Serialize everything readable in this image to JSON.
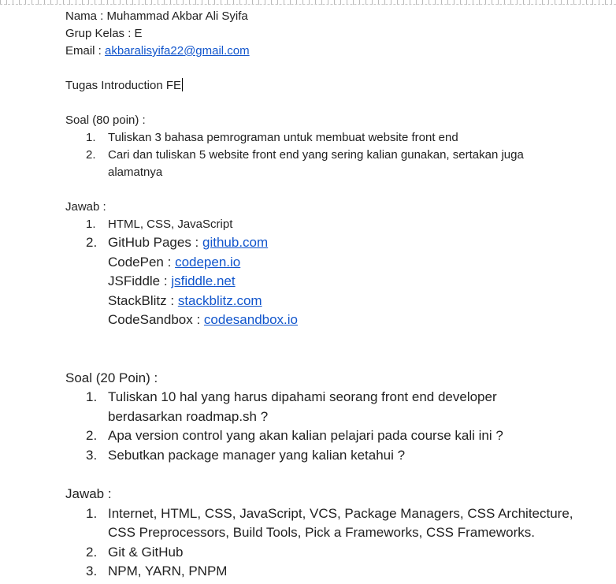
{
  "header": {
    "nama": "Nama : Muhammad Akbar Ali Syifa",
    "grup": "Grup Kelas : E",
    "email_label": "Email : ",
    "email_link": "akbaralisyifa22@gmail.com",
    "title": "Tugas Introduction FE"
  },
  "section1": {
    "soal_heading": "Soal (80 poin) :",
    "questions": [
      {
        "num": "1.",
        "text": "Tuliskan 3 bahasa pemrograman untuk membuat website front end"
      },
      {
        "num": "2.",
        "text": "Cari dan tuliskan 5 website front end yang sering kalian gunakan, sertakan juga",
        "text2": "alamatnya"
      }
    ],
    "jawab_heading": "Jawab :",
    "answer1": {
      "num": "1.",
      "text": "HTML, CSS, JavaScript"
    },
    "answer2_num": "2.",
    "sites": [
      {
        "label": "GitHub Pages : ",
        "link": "github.com"
      },
      {
        "label": "CodePen : ",
        "link": "codepen.io"
      },
      {
        "label": "JSFiddle : ",
        "link": "jsfiddle.net"
      },
      {
        "label": "StackBlitz : ",
        "link": "stackblitz.com"
      },
      {
        "label": "CodeSandbox : ",
        "link": "codesandbox.io"
      }
    ]
  },
  "section2": {
    "soal_heading": "Soal (20 Poin) :",
    "questions": [
      {
        "num": "1.",
        "text": "Tuliskan 10 hal yang harus dipahami seorang front end developer",
        "text2": "berdasarkan roadmap.sh ?"
      },
      {
        "num": "2.",
        "text": "Apa version control yang akan kalian pelajari pada course kali ini ?"
      },
      {
        "num": "3.",
        "text": "Sebutkan package manager yang kalian ketahui ?"
      }
    ],
    "jawab_heading": "Jawab :",
    "answers": [
      {
        "num": "1.",
        "text": "Internet, HTML, CSS, JavaScript, VCS, Package Managers, CSS Architecture,",
        "text2": "CSS Preprocessors, Build Tools, Pick a Frameworks, CSS Frameworks."
      },
      {
        "num": "2.",
        "text": "Git & GitHub"
      },
      {
        "num": "3.",
        "text": "NPM, YARN, PNPM"
      }
    ]
  }
}
